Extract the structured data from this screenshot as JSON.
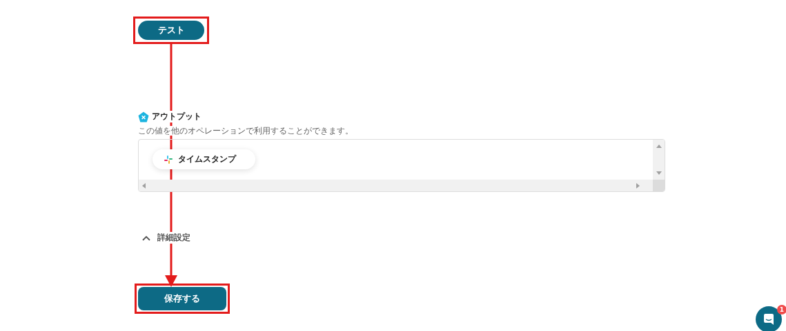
{
  "test_button": {
    "label": "テスト"
  },
  "output": {
    "title": "アウトプット",
    "description": "この値を他のオペレーションで利用することができます。",
    "chips": [
      {
        "label": "タイムスタンプ"
      }
    ]
  },
  "advanced": {
    "label": "詳細設定",
    "expanded": true
  },
  "save_button": {
    "label": "保存する"
  },
  "chat": {
    "badge": "1"
  }
}
